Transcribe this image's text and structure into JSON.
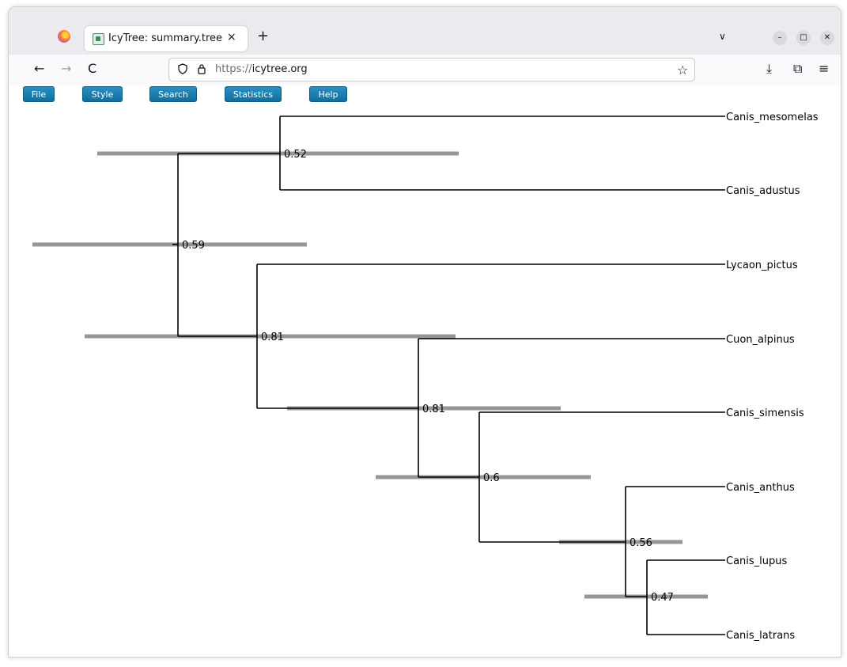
{
  "browser": {
    "tab_title": "IcyTree: summary.tree",
    "tab_close": "×",
    "new_tab": "+",
    "list_tabs": "∨",
    "url_protocol": "https://",
    "url_host": "icytree.org",
    "nav": {
      "back": "←",
      "forward": "→",
      "reload": "C"
    },
    "toolbar": {
      "download": "⤓",
      "extensions": "⧉",
      "menu": "≡"
    },
    "window": {
      "minimize": "–",
      "maximize": "□",
      "close": "✕"
    }
  },
  "menu": {
    "file": "File",
    "style": "Style",
    "search": "Search",
    "statistics": "Statistics",
    "help": "Help"
  },
  "tree": {
    "branch_color": "#000000",
    "interval_color": "#969696",
    "leaves": [
      "Canis_mesomelas",
      "Canis_adustus",
      "Lycaon_pictus",
      "Cuon_alpinus",
      "Canis_simensis",
      "Canis_anthus",
      "Canis_lupus",
      "Canis_latrans"
    ],
    "node_labels": [
      "0.59",
      "0.52",
      "0.81",
      "0.81",
      "0.6",
      "0.56",
      "0.47"
    ]
  }
}
